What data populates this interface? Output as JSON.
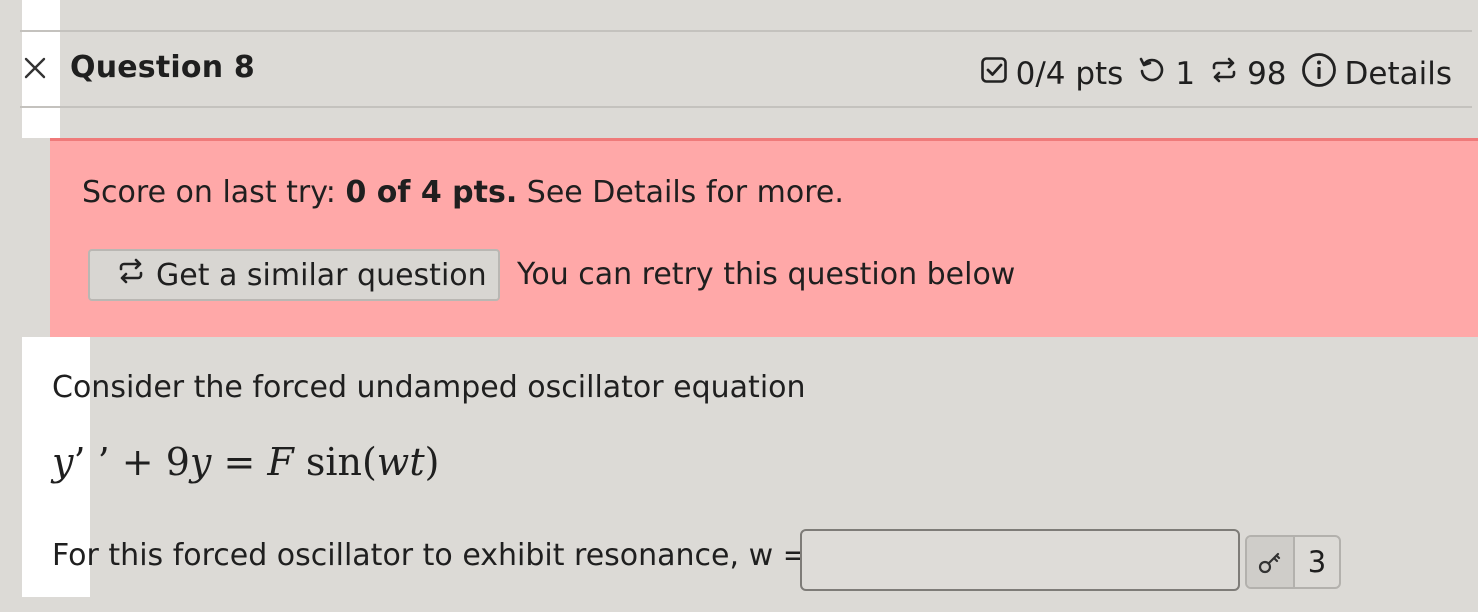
{
  "question": {
    "title": "Question 8",
    "points": "0/4 pts",
    "attempts": "1",
    "remaining": "98",
    "details_label": "Details"
  },
  "alert": {
    "score_prefix": "Score on last try:",
    "score_value": "0 of 4 pts.",
    "score_suffix": "See Details for more.",
    "similar_button": "Get a similar question",
    "retry_text": "You can retry this question below"
  },
  "body": {
    "prompt1": "Consider the forced undamped oscillator equation",
    "equation": {
      "lhs_y": "y",
      "primes": "’ ’",
      "plus": " + 9",
      "y2": "y",
      "eq": " = ",
      "F": "F",
      "sin": " sin(",
      "wt": "wt",
      "close": ")"
    },
    "prompt2": "For this forced oscillator to exhibit resonance, w =",
    "answer_value": "",
    "answer_placeholder": "",
    "key_count": "3"
  },
  "colors": {
    "background": "#dcdad6",
    "alert_bg": "#ffa8a8",
    "alert_border": "#ef7a7a"
  },
  "icons": [
    "close-icon",
    "checkbox-icon",
    "retry-icon",
    "repeat-icon",
    "info-icon",
    "key-icon"
  ]
}
